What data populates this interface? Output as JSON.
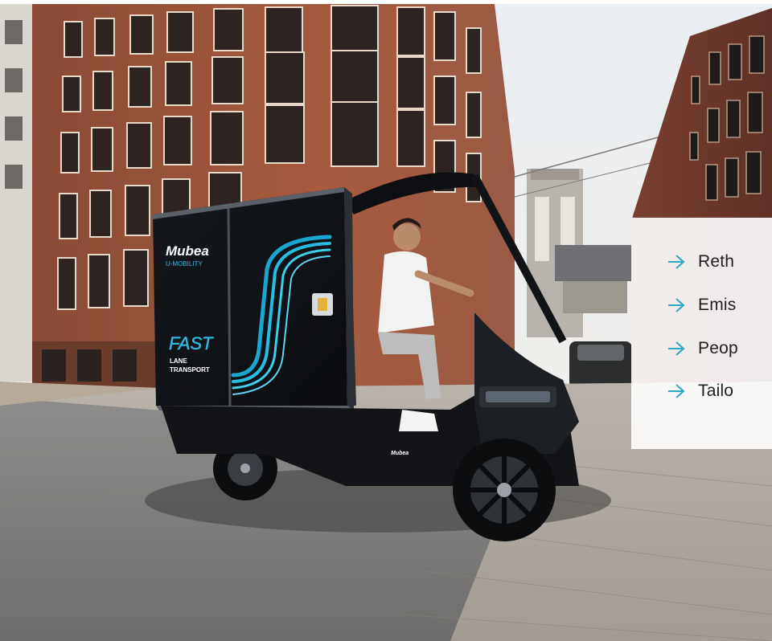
{
  "photo": {
    "box_brand": "Mubea",
    "box_sub": "U-MOBILITY",
    "box_fast": "FAST",
    "box_lane": "LANE",
    "box_transport": "TRANSPORT",
    "front_brand": "Mubea"
  },
  "panel": {
    "accent_color": "#29a9c6",
    "bullets": [
      {
        "text": "Reth",
        "icon": "arrow-right-icon"
      },
      {
        "text": "Emis",
        "icon": "arrow-right-icon"
      },
      {
        "text": "Peop",
        "icon": "arrow-right-icon"
      },
      {
        "text": "Tailo",
        "icon": "arrow-right-icon"
      }
    ]
  }
}
